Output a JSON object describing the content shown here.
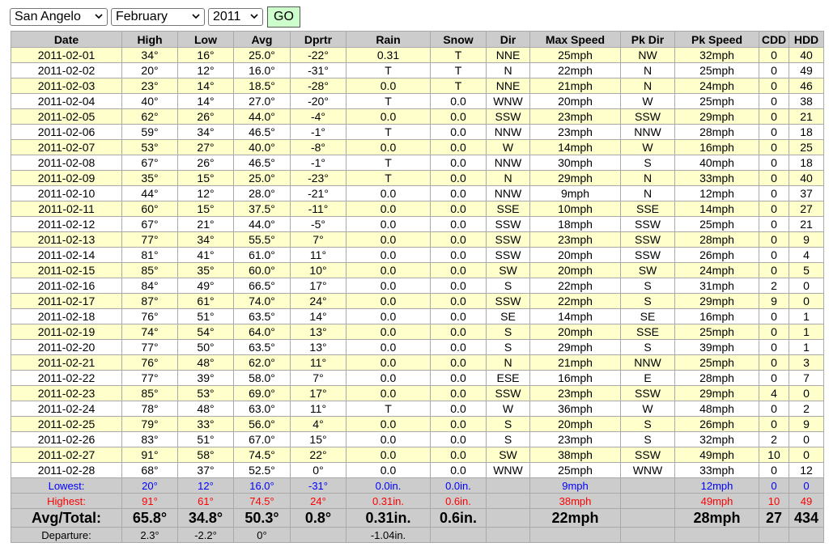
{
  "controls": {
    "city": "San Angelo",
    "month": "February",
    "year": "2011",
    "go_label": "GO"
  },
  "table": {
    "headers": [
      "Date",
      "High",
      "Low",
      "Avg",
      "Dprtr",
      "Rain",
      "Snow",
      "Dir",
      "Max Speed",
      "Pk Dir",
      "Pk Speed",
      "CDD",
      "HDD"
    ],
    "rows": [
      [
        "2011-02-01",
        "34°",
        "16°",
        "25.0°",
        "-22°",
        "0.31",
        "T",
        "NNE",
        "25mph",
        "NW",
        "32mph",
        "0",
        "40"
      ],
      [
        "2011-02-02",
        "20°",
        "12°",
        "16.0°",
        "-31°",
        "T",
        "T",
        "N",
        "22mph",
        "N",
        "25mph",
        "0",
        "49"
      ],
      [
        "2011-02-03",
        "23°",
        "14°",
        "18.5°",
        "-28°",
        "0.0",
        "T",
        "NNE",
        "21mph",
        "N",
        "24mph",
        "0",
        "46"
      ],
      [
        "2011-02-04",
        "40°",
        "14°",
        "27.0°",
        "-20°",
        "T",
        "0.0",
        "WNW",
        "20mph",
        "W",
        "25mph",
        "0",
        "38"
      ],
      [
        "2011-02-05",
        "62°",
        "26°",
        "44.0°",
        "-4°",
        "0.0",
        "0.0",
        "SSW",
        "23mph",
        "SSW",
        "29mph",
        "0",
        "21"
      ],
      [
        "2011-02-06",
        "59°",
        "34°",
        "46.5°",
        "-1°",
        "T",
        "0.0",
        "NNW",
        "23mph",
        "NNW",
        "28mph",
        "0",
        "18"
      ],
      [
        "2011-02-07",
        "53°",
        "27°",
        "40.0°",
        "-8°",
        "0.0",
        "0.0",
        "W",
        "14mph",
        "W",
        "16mph",
        "0",
        "25"
      ],
      [
        "2011-02-08",
        "67°",
        "26°",
        "46.5°",
        "-1°",
        "T",
        "0.0",
        "NNW",
        "30mph",
        "S",
        "40mph",
        "0",
        "18"
      ],
      [
        "2011-02-09",
        "35°",
        "15°",
        "25.0°",
        "-23°",
        "T",
        "0.0",
        "N",
        "29mph",
        "N",
        "33mph",
        "0",
        "40"
      ],
      [
        "2011-02-10",
        "44°",
        "12°",
        "28.0°",
        "-21°",
        "0.0",
        "0.0",
        "NNW",
        "9mph",
        "N",
        "12mph",
        "0",
        "37"
      ],
      [
        "2011-02-11",
        "60°",
        "15°",
        "37.5°",
        "-11°",
        "0.0",
        "0.0",
        "SSE",
        "10mph",
        "SSE",
        "14mph",
        "0",
        "27"
      ],
      [
        "2011-02-12",
        "67°",
        "21°",
        "44.0°",
        "-5°",
        "0.0",
        "0.0",
        "SSW",
        "18mph",
        "SSW",
        "25mph",
        "0",
        "21"
      ],
      [
        "2011-02-13",
        "77°",
        "34°",
        "55.5°",
        "7°",
        "0.0",
        "0.0",
        "SSW",
        "23mph",
        "SSW",
        "28mph",
        "0",
        "9"
      ],
      [
        "2011-02-14",
        "81°",
        "41°",
        "61.0°",
        "11°",
        "0.0",
        "0.0",
        "SSW",
        "20mph",
        "SSW",
        "26mph",
        "0",
        "4"
      ],
      [
        "2011-02-15",
        "85°",
        "35°",
        "60.0°",
        "10°",
        "0.0",
        "0.0",
        "SW",
        "20mph",
        "SW",
        "24mph",
        "0",
        "5"
      ],
      [
        "2011-02-16",
        "84°",
        "49°",
        "66.5°",
        "17°",
        "0.0",
        "0.0",
        "S",
        "22mph",
        "S",
        "31mph",
        "2",
        "0"
      ],
      [
        "2011-02-17",
        "87°",
        "61°",
        "74.0°",
        "24°",
        "0.0",
        "0.0",
        "SSW",
        "22mph",
        "S",
        "29mph",
        "9",
        "0"
      ],
      [
        "2011-02-18",
        "76°",
        "51°",
        "63.5°",
        "14°",
        "0.0",
        "0.0",
        "SE",
        "14mph",
        "SE",
        "16mph",
        "0",
        "1"
      ],
      [
        "2011-02-19",
        "74°",
        "54°",
        "64.0°",
        "13°",
        "0.0",
        "0.0",
        "S",
        "20mph",
        "SSE",
        "25mph",
        "0",
        "1"
      ],
      [
        "2011-02-20",
        "77°",
        "50°",
        "63.5°",
        "13°",
        "0.0",
        "0.0",
        "S",
        "29mph",
        "S",
        "39mph",
        "0",
        "1"
      ],
      [
        "2011-02-21",
        "76°",
        "48°",
        "62.0°",
        "11°",
        "0.0",
        "0.0",
        "N",
        "21mph",
        "NNW",
        "25mph",
        "0",
        "3"
      ],
      [
        "2011-02-22",
        "77°",
        "39°",
        "58.0°",
        "7°",
        "0.0",
        "0.0",
        "ESE",
        "16mph",
        "E",
        "28mph",
        "0",
        "7"
      ],
      [
        "2011-02-23",
        "85°",
        "53°",
        "69.0°",
        "17°",
        "0.0",
        "0.0",
        "SSW",
        "23mph",
        "SSW",
        "29mph",
        "4",
        "0"
      ],
      [
        "2011-02-24",
        "78°",
        "48°",
        "63.0°",
        "11°",
        "T",
        "0.0",
        "W",
        "36mph",
        "W",
        "48mph",
        "0",
        "2"
      ],
      [
        "2011-02-25",
        "79°",
        "33°",
        "56.0°",
        "4°",
        "0.0",
        "0.0",
        "S",
        "20mph",
        "S",
        "26mph",
        "0",
        "9"
      ],
      [
        "2011-02-26",
        "83°",
        "51°",
        "67.0°",
        "15°",
        "0.0",
        "0.0",
        "S",
        "23mph",
        "S",
        "32mph",
        "2",
        "0"
      ],
      [
        "2011-02-27",
        "91°",
        "58°",
        "74.5°",
        "22°",
        "0.0",
        "0.0",
        "SW",
        "38mph",
        "SSW",
        "49mph",
        "10",
        "0"
      ],
      [
        "2011-02-28",
        "68°",
        "37°",
        "52.5°",
        "0°",
        "0.0",
        "0.0",
        "WNW",
        "25mph",
        "WNW",
        "33mph",
        "0",
        "12"
      ]
    ],
    "lowest": [
      "Lowest:",
      "20°",
      "12°",
      "16.0°",
      "-31°",
      "0.0in.",
      "0.0in.",
      "",
      "9mph",
      "",
      "12mph",
      "0",
      "0"
    ],
    "highest": [
      "Highest:",
      "91°",
      "61°",
      "74.5°",
      "24°",
      "0.31in.",
      "0.6in.",
      "",
      "38mph",
      "",
      "49mph",
      "10",
      "49"
    ],
    "avg_total": [
      "Avg/Total:",
      "65.8°",
      "34.8°",
      "50.3°",
      "0.8°",
      "0.31in.",
      "0.6in.",
      "",
      "22mph",
      "",
      "28mph",
      "27",
      "434"
    ],
    "departure": [
      "Departure:",
      "2.3°",
      "-2.2°",
      "0°",
      "",
      "-1.04in.",
      "",
      "",
      "",
      "",
      "",
      "",
      ""
    ]
  },
  "colors": {
    "row_highlight": "#ffffcc",
    "header_bg": "#cccccc",
    "lowest_text": "#0000ff",
    "highest_text": "#ff0000",
    "go_button_bg": "#ccffcc"
  }
}
